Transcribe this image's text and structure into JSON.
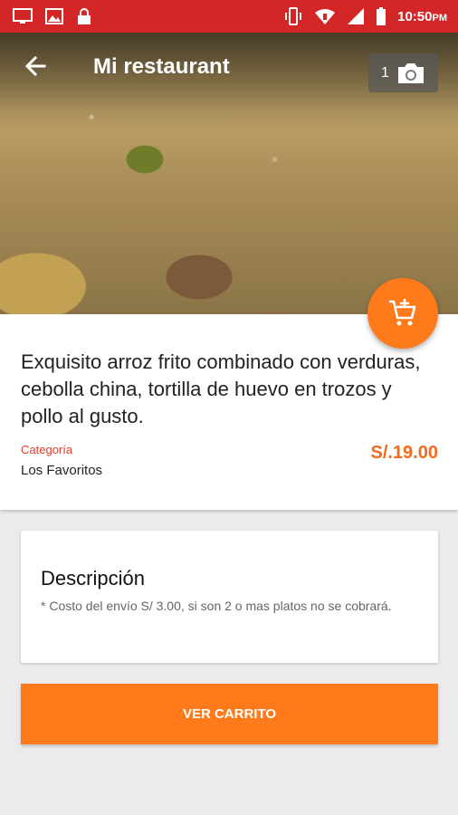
{
  "status_bar": {
    "time": "10:50",
    "ampm": "PM",
    "icons": [
      "monitor-icon",
      "image-icon",
      "lock-icon",
      "vibrate-icon",
      "wifi-icon",
      "signal-icon",
      "battery-icon"
    ]
  },
  "header": {
    "title": "Mi restaurant",
    "back_icon": "arrow-left-icon"
  },
  "photo_badge": {
    "count": "1",
    "icon": "camera-icon"
  },
  "fab": {
    "icon": "add-to-cart-icon"
  },
  "product": {
    "description": "Exquisito arroz frito combinado con verduras, cebolla china, tortilla de huevo en trozos y pollo al gusto.",
    "category_label": "Categoría",
    "category_value": "Los Favoritos",
    "price": "S/.19.00"
  },
  "details": {
    "title": "Descripción",
    "text": "* Costo del envío S/ 3.00, si son 2 o mas platos no se cobrará."
  },
  "cart_button": {
    "label": "VER CARRITO"
  },
  "colors": {
    "status_bar": "#d32626",
    "accent": "#ff7a1a",
    "price": "#f26b1d",
    "category_label": "#e53a2a",
    "background": "#ebebeb"
  }
}
